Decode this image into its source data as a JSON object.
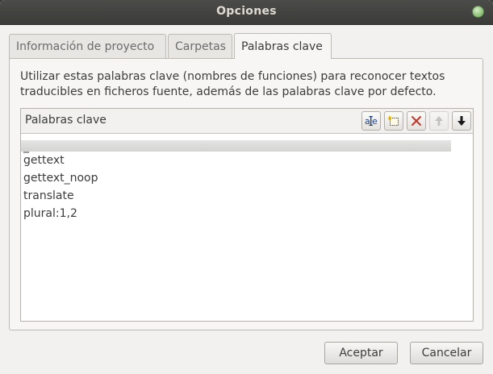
{
  "window": {
    "title": "Opciones"
  },
  "tabs": [
    {
      "label": "Información de proyecto"
    },
    {
      "label": "Carpetas"
    },
    {
      "label": "Palabras clave"
    }
  ],
  "panel": {
    "description": "Utilizar estas palabras clave (nombres de funciones) para reconocer textos traducibles en ficheros fuente, además de las palabras clave por defecto.",
    "list_header": "Palabras clave",
    "toolbar_icons": [
      "rename-icon",
      "add-icon",
      "delete-icon",
      "move-up-icon",
      "move-down-icon"
    ],
    "items": [
      "_",
      "gettext",
      "gettext_noop",
      "translate",
      "plural:1,2"
    ]
  },
  "buttons": {
    "accept": "Aceptar",
    "cancel": "Cancelar"
  },
  "colors": {
    "delete": "#c0392b",
    "close_button": "#8fbf78"
  }
}
